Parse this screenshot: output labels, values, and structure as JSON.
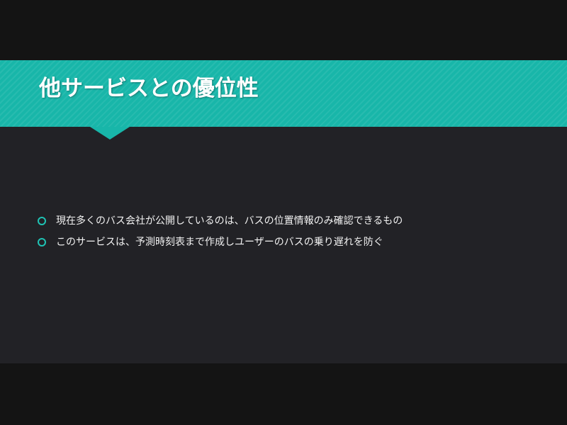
{
  "slide": {
    "title": "他サービスとの優位性",
    "bullets": [
      {
        "text": "現在多くのバス会社が公開しているのは、バスの位置情報のみ確認できるもの"
      },
      {
        "text": "このサービスは、予測時刻表まで作成しユーザーのバスの乗り遅れを防ぐ"
      }
    ]
  },
  "colors": {
    "background": "#141414",
    "slide_background": "#222226",
    "accent": "#18b6a9",
    "bullet_icon": "#1fc3b4",
    "text": "#f2f2f2"
  },
  "icons": {
    "bullet": "hollow-circle-icon"
  }
}
